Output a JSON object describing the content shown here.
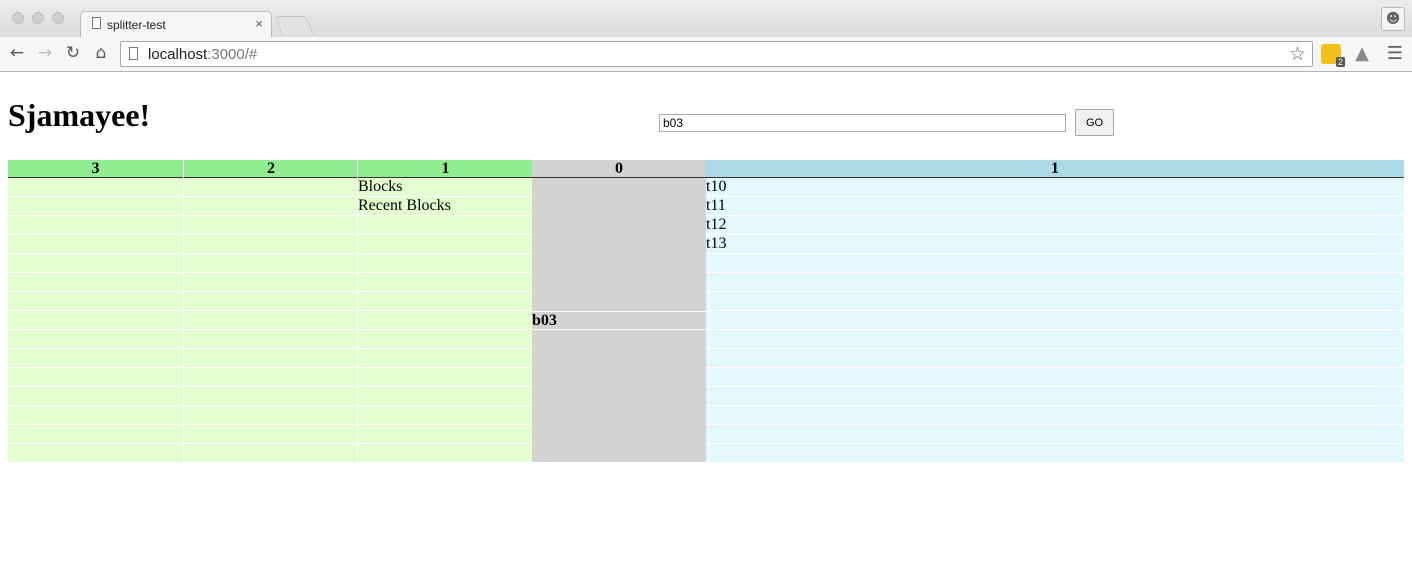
{
  "browser": {
    "tab_title": "splitter-test",
    "tab_close": "×",
    "url_host": "localhost",
    "url_rest": ":3000/#",
    "extension_badge": "2"
  },
  "page": {
    "title": "Sjamayee!",
    "search": {
      "value": "b03"
    },
    "go_label": "GO"
  },
  "columns": [
    {
      "header": "3",
      "cells": [
        "",
        "",
        "",
        "",
        "",
        "",
        "",
        "",
        "",
        "",
        "",
        "",
        "",
        "",
        ""
      ]
    },
    {
      "header": "2",
      "cells": [
        "",
        "",
        "",
        "",
        "",
        "",
        "",
        "",
        "",
        "",
        "",
        "",
        "",
        "",
        ""
      ]
    },
    {
      "header": "1",
      "cells": [
        "Blocks",
        "Recent Blocks",
        "",
        "",
        "",
        "",
        "",
        "",
        "",
        "",
        "",
        "",
        "",
        "",
        ""
      ]
    },
    {
      "header": "0",
      "cells": [
        "",
        "",
        "",
        "",
        "",
        "",
        "",
        "b03",
        "",
        "",
        "",
        "",
        "",
        "",
        ""
      ]
    },
    {
      "header": "1",
      "cells": [
        "t10",
        "t11",
        "t12",
        "t13",
        "",
        "",
        "",
        "",
        "",
        "",
        "",
        "",
        "",
        "",
        ""
      ]
    }
  ]
}
